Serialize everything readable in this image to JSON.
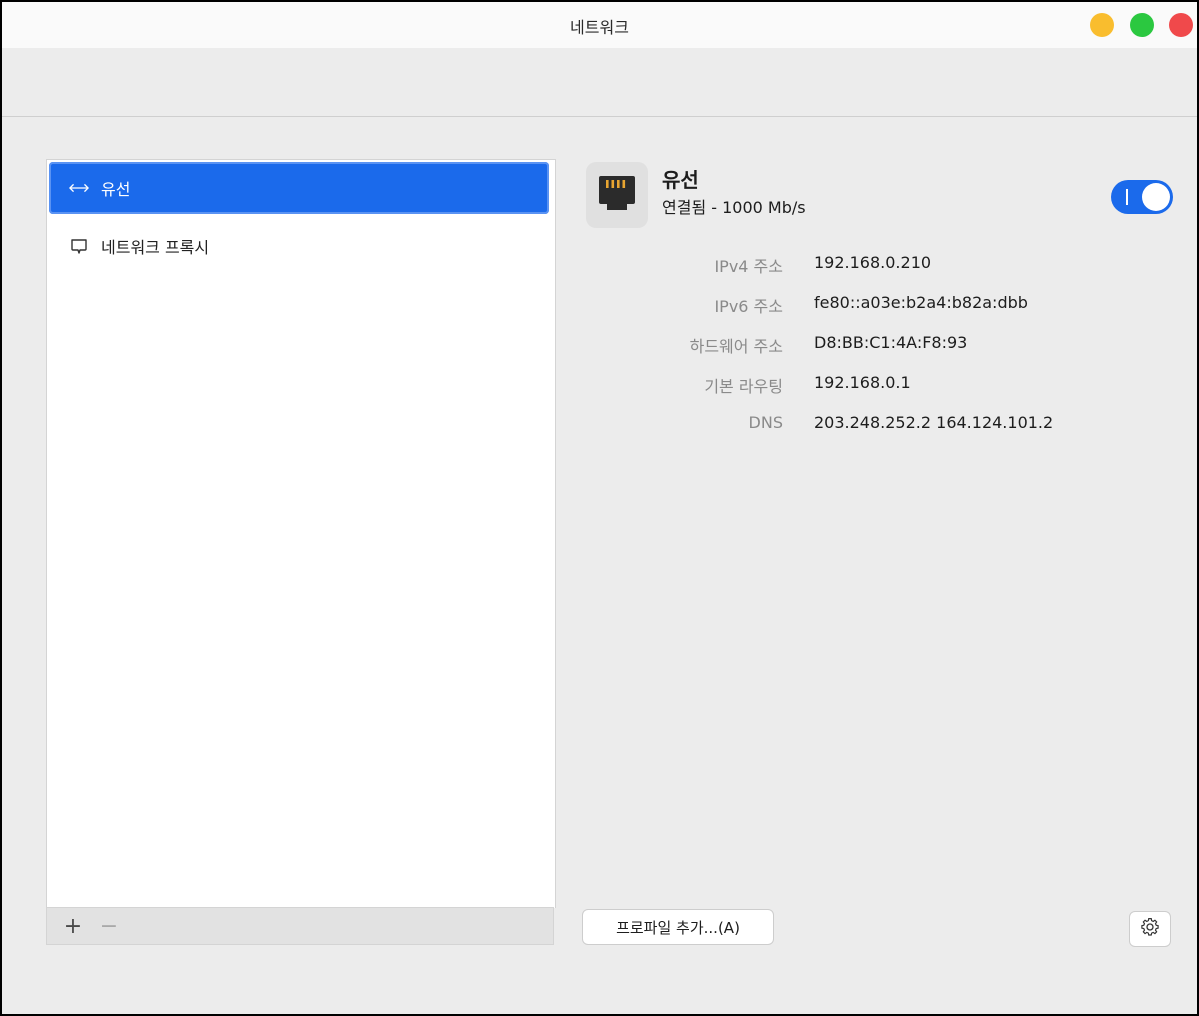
{
  "window": {
    "title": "네트워크"
  },
  "sidebar": {
    "items": [
      {
        "label": "유선",
        "icon": "ethernet-arrows-icon",
        "selected": true
      },
      {
        "label": "네트워크 프록시",
        "icon": "proxy-icon",
        "selected": false
      }
    ],
    "footer": {
      "add_label": "+",
      "remove_label": "−"
    }
  },
  "detail": {
    "name": "유선",
    "status": "연결됨 - 1000 Mb/s",
    "enabled": true,
    "info": [
      {
        "label": "IPv4 주소",
        "value": "192.168.0.210"
      },
      {
        "label": "IPv6 주소",
        "value": "fe80::a03e:b2a4:b82a:dbb"
      },
      {
        "label": "하드웨어 주소",
        "value": "D8:BB:C1:4A:F8:93"
      },
      {
        "label": "기본 라우팅",
        "value": "192.168.0.1"
      },
      {
        "label": "DNS",
        "value": "203.248.252.2 164.124.101.2"
      }
    ],
    "add_profile_label": "프로파일 추가...(A)"
  },
  "colors": {
    "accent": "#1b6aeb",
    "traffic_yellow": "#f9bd2e",
    "traffic_green": "#2bc840",
    "traffic_red": "#f0494b"
  }
}
